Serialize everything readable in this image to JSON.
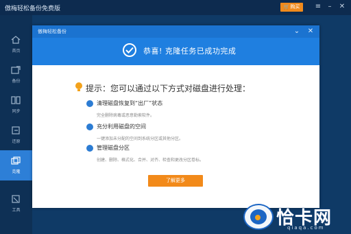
{
  "app": {
    "title": "傲梅轻松备份免费版",
    "buy_label": "购买"
  },
  "sidebar": {
    "items": [
      {
        "label": "首页",
        "icon": "home-icon"
      },
      {
        "label": "备份",
        "icon": "backup-icon"
      },
      {
        "label": "同步",
        "icon": "sync-icon"
      },
      {
        "label": "还原",
        "icon": "restore-icon"
      },
      {
        "label": "克隆",
        "icon": "clone-icon",
        "active": true
      },
      {
        "label": "工具",
        "icon": "tools-icon"
      }
    ]
  },
  "dialog": {
    "title": "傲梅轻松备份",
    "banner_text": "恭喜! 克隆任务已成功完成",
    "tip": "提示：您可以通过以下方式对磁盘进行处理：",
    "items": [
      {
        "title": "清理磁盘恢复到“出厂”状态",
        "desc": "完全删除病毒或恶意勒索软件。",
        "icon": "shield-icon"
      },
      {
        "title": "充分利用磁盘的空间",
        "desc": "一键添加未分配的空间到系统分区或其他分区。",
        "icon": "box-icon"
      },
      {
        "title": "管理磁盘分区",
        "desc": "创建、删除、格式化、合并、对齐、检查和更改分区卷标。",
        "icon": "pie-icon"
      }
    ],
    "learn_more_label": "了解更多"
  },
  "watermark": {
    "text": "恰卡网",
    "sub": "qiaqa.com"
  },
  "colors": {
    "accent": "#1f7fe0",
    "orange": "#f28a1a",
    "sidebar_active": "#2d7fd7"
  }
}
